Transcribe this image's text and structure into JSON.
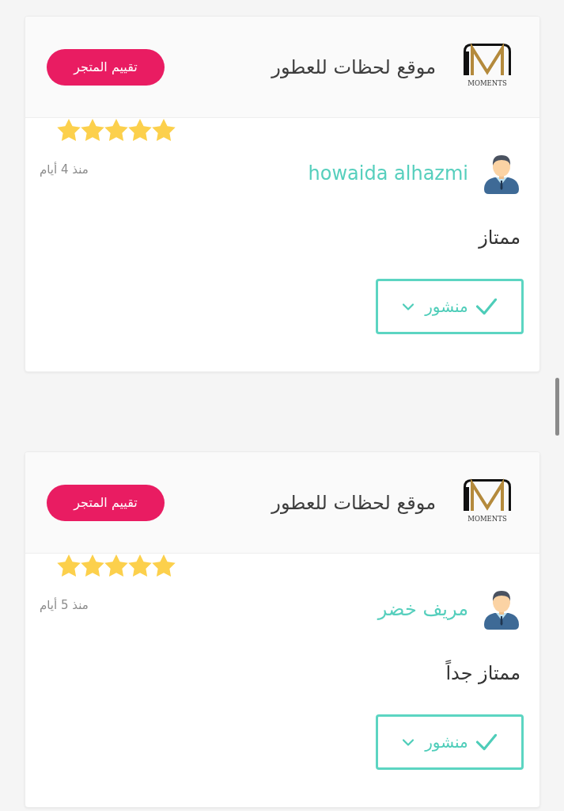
{
  "reviews": [
    {
      "store": {
        "logo_text": "MOMENTS",
        "name": "موقع لحظات للعطور"
      },
      "rate_store_button": "تقييم المتجر",
      "stars": 5,
      "reviewer": "howaida alhazmi",
      "time": "منذ 4 أيام",
      "comment": "ممتاز",
      "status": "منشور"
    },
    {
      "store": {
        "logo_text": "MOMENTS",
        "name": "موقع لحظات للعطور"
      },
      "rate_store_button": "تقييم المتجر",
      "stars": 5,
      "reviewer": "مريف خضر",
      "time": "منذ 5 أيام",
      "comment": "ممتاز جداً",
      "status": "منشور"
    }
  ]
}
